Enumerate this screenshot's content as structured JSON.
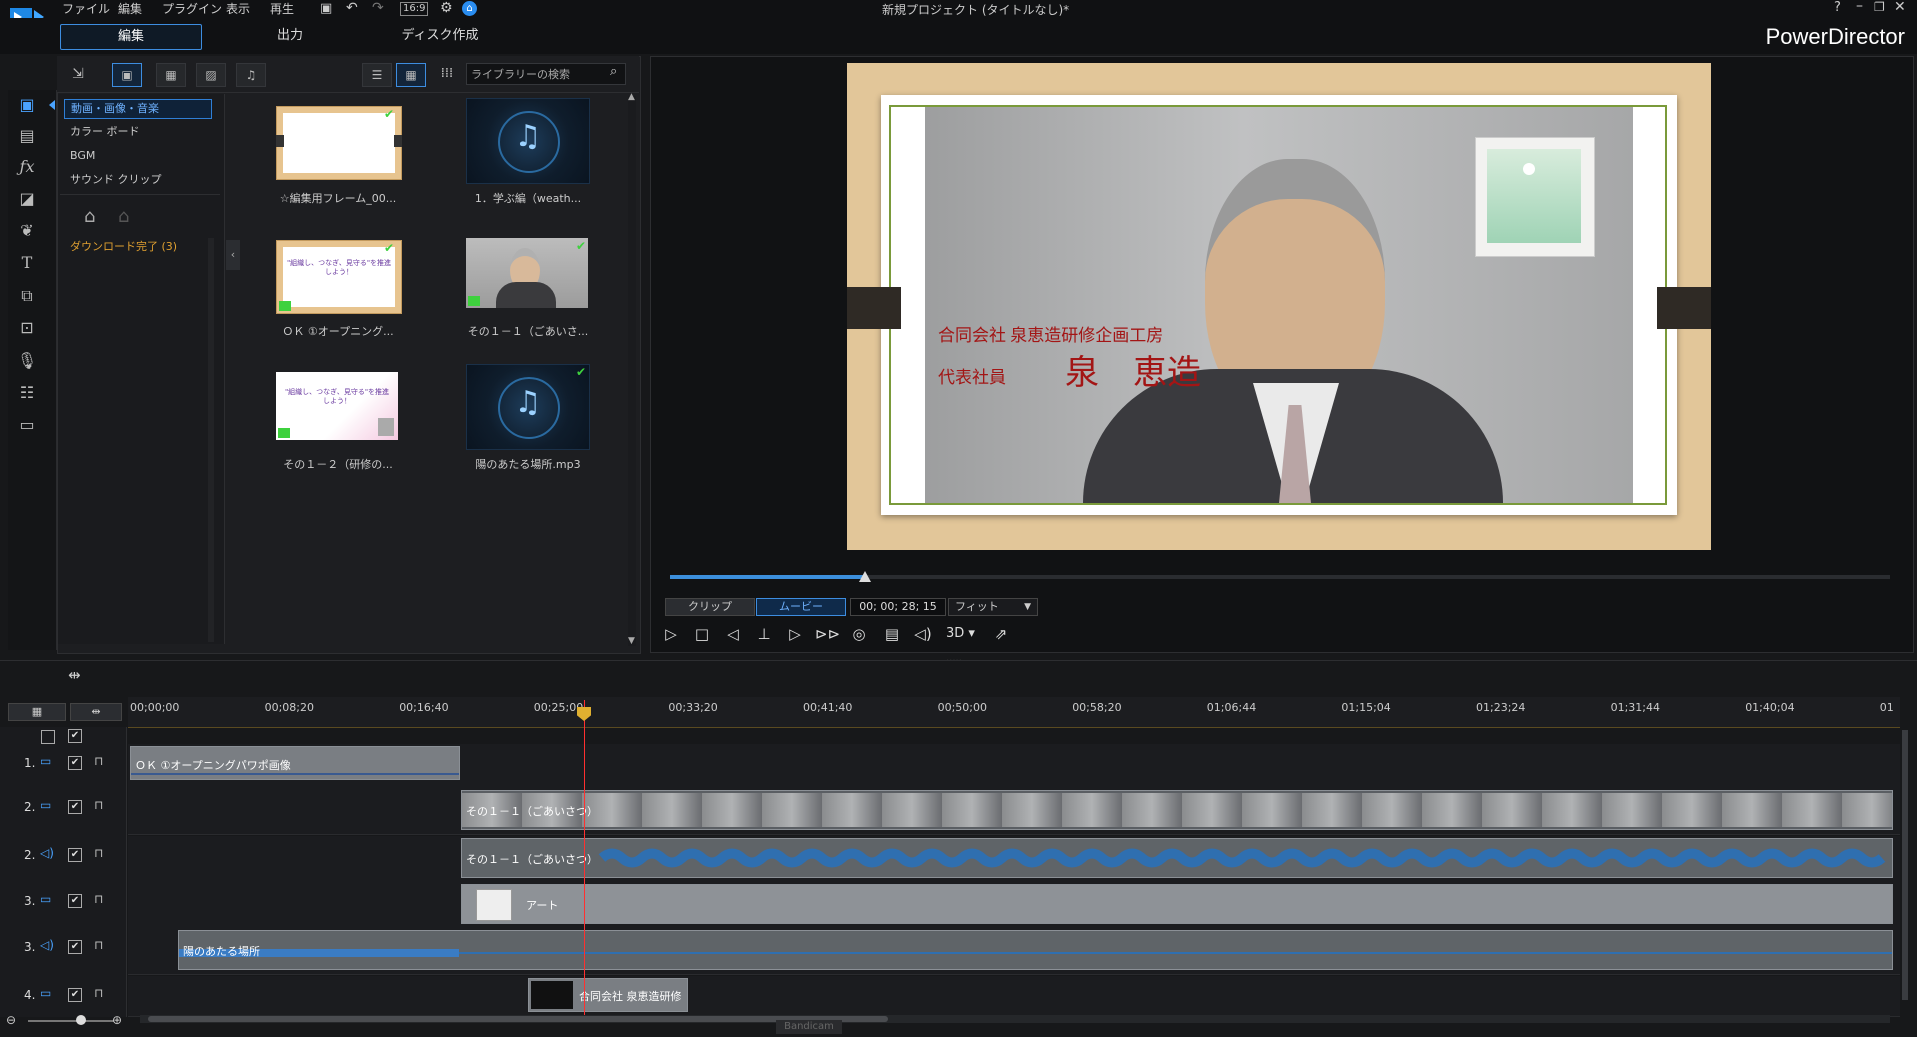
{
  "app": {
    "title": "新規プロジェクト (タイトルなし)*",
    "brand": "PowerDirector",
    "menu": [
      "ファイル",
      "編集",
      "プラグイン",
      "表示",
      "再生"
    ],
    "aspect": "16:9",
    "help": "?",
    "tabs": [
      "編集",
      "出力",
      "ディスク作成"
    ],
    "active_tab": "編集"
  },
  "library": {
    "search_placeholder": "ライブラリーの検索",
    "categories": [
      "動画・画像・音楽",
      "カラー ボード",
      "BGM",
      "サウンド クリップ"
    ],
    "selected_category": "動画・画像・音楽",
    "download_status": "ダウンロード完了 (3)",
    "items": [
      {
        "label": "☆編集用フレーム_00...",
        "type": "image",
        "checked": true
      },
      {
        "label": "1．学ぶ編（weath...",
        "type": "audio",
        "checked": false
      },
      {
        "label": "ＯＫ ①オープニング...",
        "type": "image",
        "checked": true
      },
      {
        "label": "その１－１（ごあいさ...",
        "type": "video",
        "checked": true
      },
      {
        "label": "その１－２（研修の...",
        "type": "image",
        "checked": false
      },
      {
        "label": "陽のあたる場所.mp3",
        "type": "audio",
        "checked": true
      }
    ],
    "thumb_text_1": "\"組織し、つなぎ、見守る\"を推進しよう！",
    "thumb_text_2": "\"組織し、つなぎ、見守る\"を推進しよう！"
  },
  "preview": {
    "overlay_company": "合同会社 泉恵造研修企画工房",
    "overlay_role": "代表社員",
    "overlay_name": "泉　恵造",
    "mode_clip": "クリップ",
    "mode_movie": "ムービー",
    "timecode": "00; 00; 28; 15",
    "fit": "フィット",
    "three_d": "3D",
    "progress": 0.16
  },
  "timeline": {
    "ticks": [
      "00;00;00",
      "00;08;20",
      "00;16;40",
      "00;25;00",
      "00;33;20",
      "00;41;40",
      "00;50;00",
      "00;58;20",
      "01;06;44",
      "01;15;04",
      "01;23;24",
      "01;31;44",
      "01;40;04",
      "01"
    ],
    "tracks": [
      {
        "label": "1.",
        "kind": "video",
        "clip": "ＯＫ ①オープニングパワポ画像"
      },
      {
        "label": "2.",
        "kind": "video",
        "clip": "その１－１（ごあいさつ）"
      },
      {
        "label": "2.",
        "kind": "audio",
        "clip": "その１－１（ごあいさつ）"
      },
      {
        "label": "3.",
        "kind": "video",
        "clip": "アート"
      },
      {
        "label": "3.",
        "kind": "audio",
        "clip": "陽のあたる場所"
      },
      {
        "label": "4.",
        "kind": "video",
        "clip": "合同会社 泉恵造研修"
      }
    ]
  },
  "watermark": "Bandicam"
}
